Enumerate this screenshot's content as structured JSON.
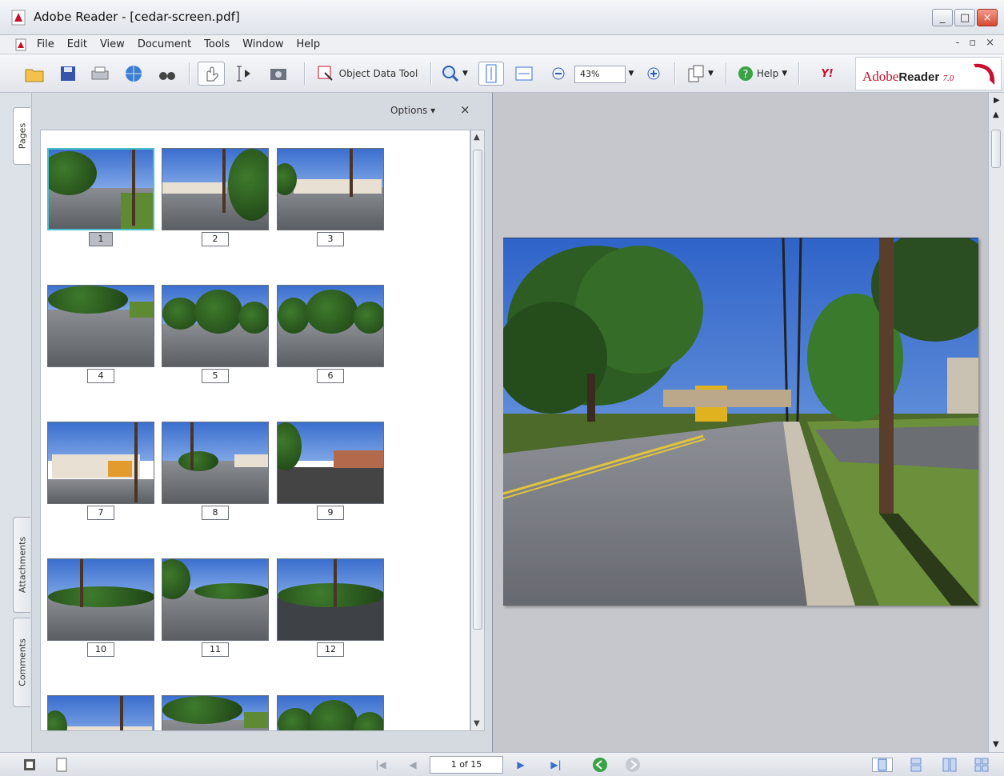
{
  "window": {
    "title": "Adobe Reader - [cedar-screen.pdf]",
    "minimize": "_",
    "maximize": "□",
    "close": "×"
  },
  "menu": {
    "items": [
      "File",
      "Edit",
      "View",
      "Document",
      "Tools",
      "Window",
      "Help"
    ],
    "doc_minimize": "-",
    "doc_restore": "▫",
    "doc_close": "×"
  },
  "toolbar": {
    "object_data_tool": "Object Data Tool",
    "zoom_value": "43%",
    "help_label": "Help",
    "yahoo": "Y!",
    "brand_adobe": "Adobe",
    "brand_reader": "Reader",
    "brand_version": "7.0"
  },
  "left_tabs": {
    "pages": "Pages",
    "attachments": "Attachments",
    "comments": "Comments"
  },
  "pages_pane": {
    "options_label": "Options ▾",
    "close": "×",
    "selected_page": 1,
    "thumbnails": [
      "1",
      "2",
      "3",
      "4",
      "5",
      "6",
      "7",
      "8",
      "9",
      "10",
      "11",
      "12"
    ]
  },
  "status": {
    "page_indicator": "1 of 15"
  },
  "colors": {
    "selection": "#49c0c9",
    "brand_red": "#c8102e"
  }
}
